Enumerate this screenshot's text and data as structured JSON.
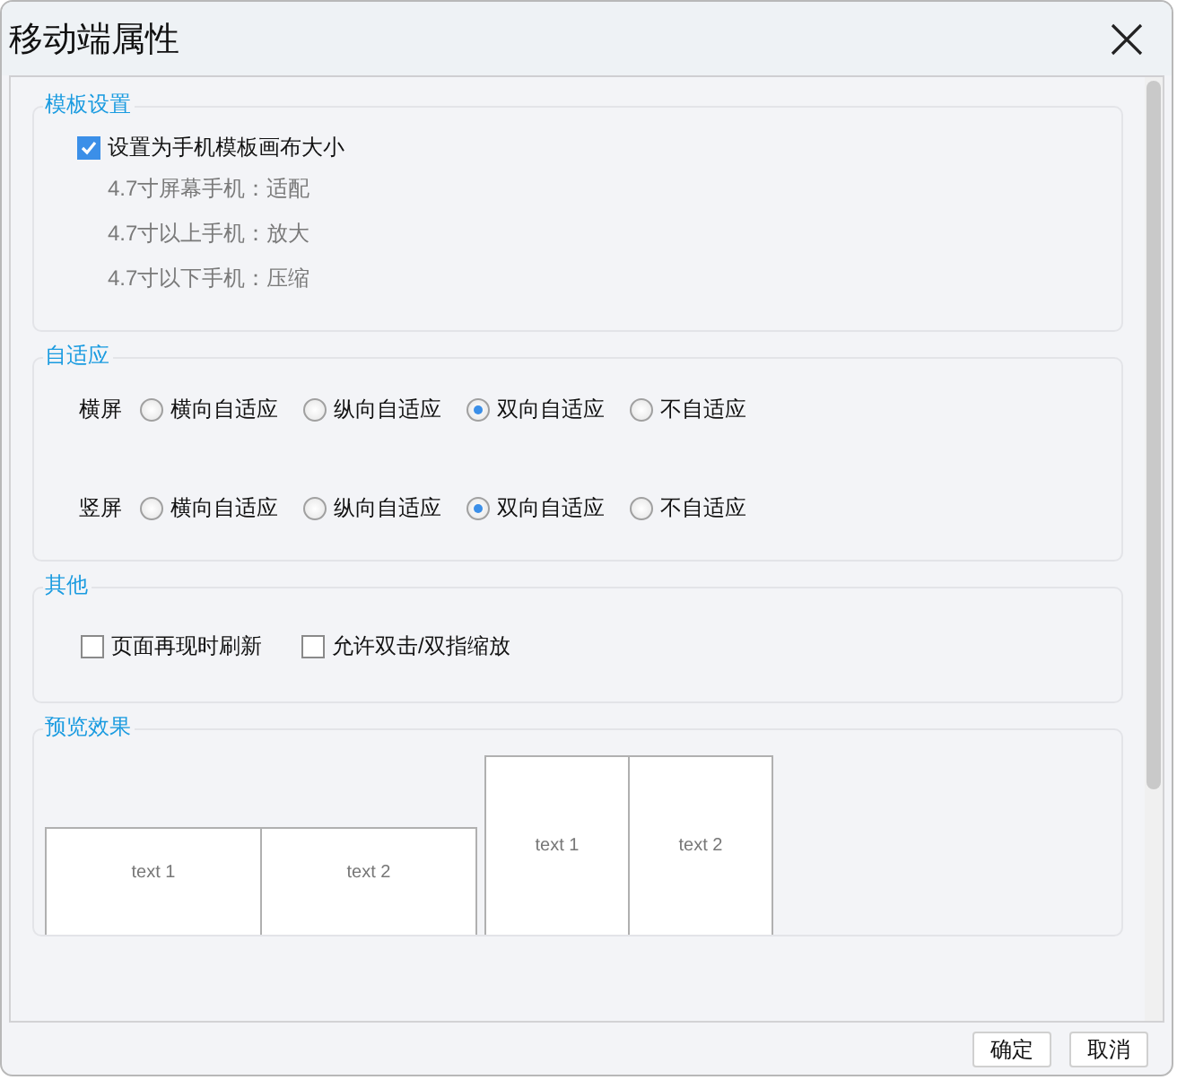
{
  "window": {
    "title": "移动端属性"
  },
  "template_settings": {
    "title": "模板设置",
    "checkbox": {
      "label": "设置为手机模板画布大小",
      "checked": true
    },
    "notes": [
      "4.7寸屏幕手机：适配",
      "4.7寸以上手机：放大",
      "4.7寸以下手机：压缩"
    ]
  },
  "adaptive": {
    "title": "自适应",
    "rows": [
      {
        "label": "横屏",
        "options": [
          {
            "label": "横向自适应",
            "selected": false
          },
          {
            "label": "纵向自适应",
            "selected": false
          },
          {
            "label": "双向自适应",
            "selected": true
          },
          {
            "label": "不自适应",
            "selected": false
          }
        ]
      },
      {
        "label": "竖屏",
        "options": [
          {
            "label": "横向自适应",
            "selected": false
          },
          {
            "label": "纵向自适应",
            "selected": false
          },
          {
            "label": "双向自适应",
            "selected": true
          },
          {
            "label": "不自适应",
            "selected": false
          }
        ]
      }
    ]
  },
  "other": {
    "title": "其他",
    "options": [
      {
        "label": "页面再现时刷新",
        "checked": false
      },
      {
        "label": "允许双击/双指缩放",
        "checked": false
      }
    ]
  },
  "preview": {
    "title": "预览效果",
    "landscape": [
      "text 1",
      "text 2"
    ],
    "portrait": [
      "text 1",
      "text 2"
    ]
  },
  "buttons": [
    "确定",
    "取消"
  ]
}
